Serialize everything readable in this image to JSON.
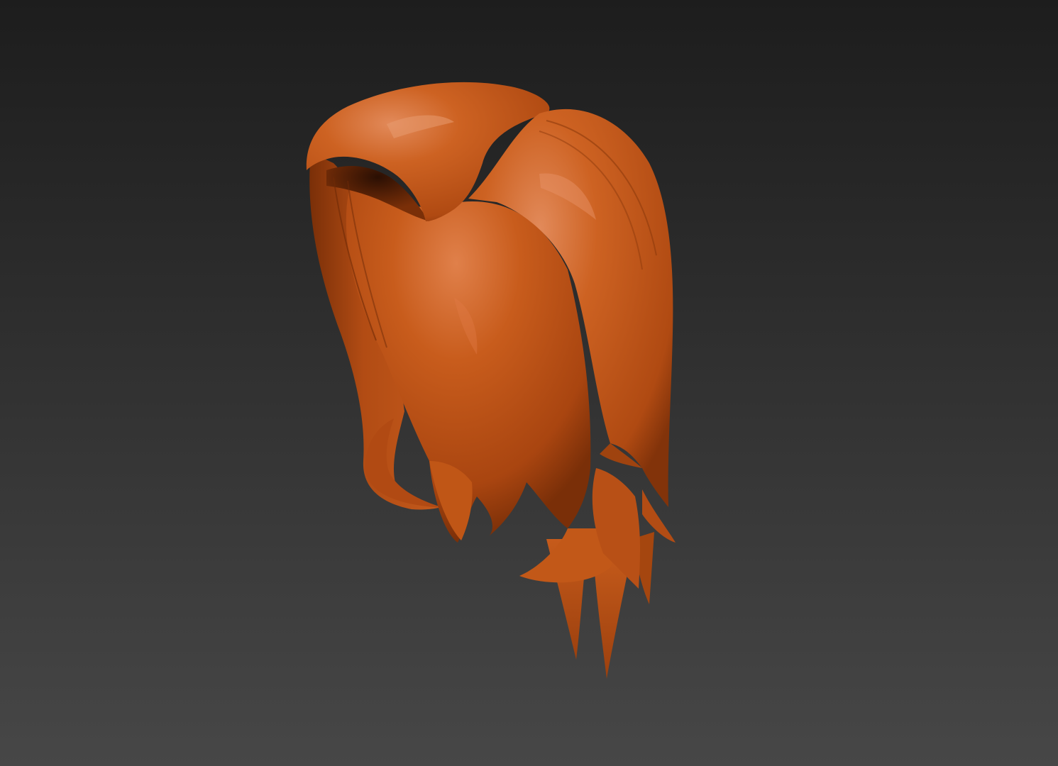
{
  "viewport": {
    "background_top": "#1d1d1d",
    "background_bottom": "#474747"
  },
  "model": {
    "object": "hair-mesh",
    "material_color": "#c4571a",
    "highlight_color": "#e28a5a",
    "shadow_color": "#6a2606"
  }
}
